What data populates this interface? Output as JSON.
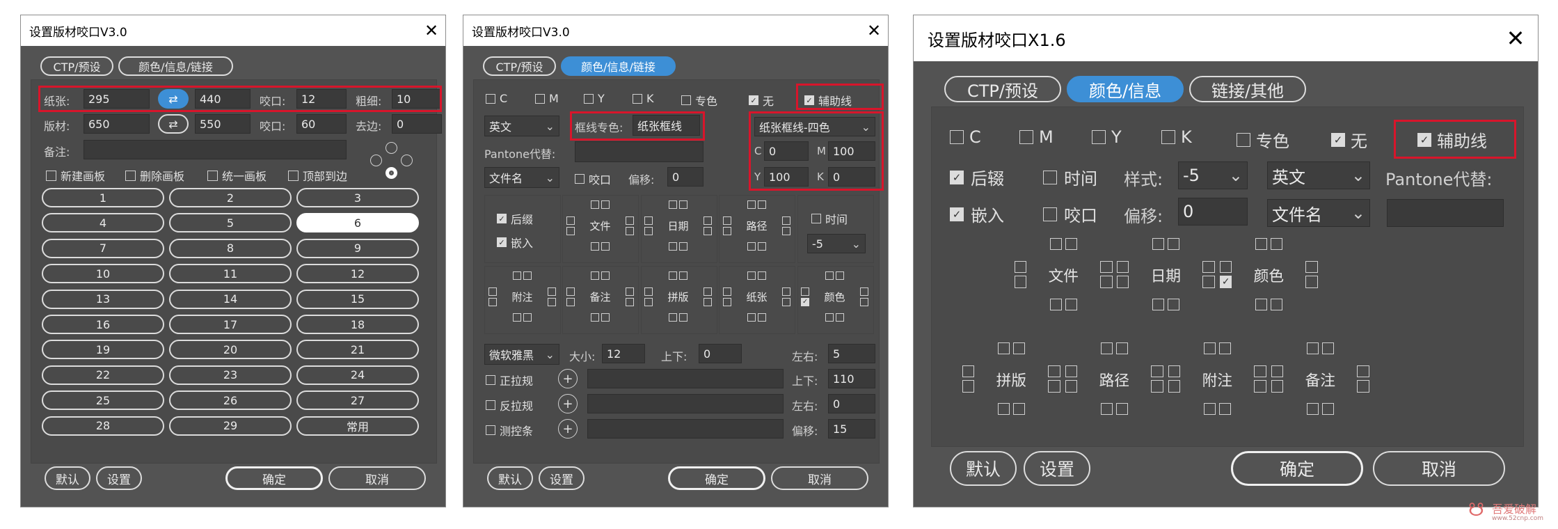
{
  "colors": {
    "window_bg": "#535353",
    "accent": "#3d8fd6",
    "highlight": "#d8152b"
  },
  "panel1": {
    "title": "设置版材咬口V3.0",
    "tabs": [
      "CTP/预设",
      "颜色/信息/链接"
    ],
    "paper_label": "纸张:",
    "paper_w": "295",
    "paper_h": "440",
    "bite_label": "咬口:",
    "paper_bite": "12",
    "thickness_label": "粗细:",
    "thickness": "10",
    "plate_label": "版材:",
    "plate_w": "650",
    "plate_h": "550",
    "plate_bite": "60",
    "margin_label": "去边:",
    "margin": "0",
    "note_label": "备注:",
    "options": [
      "新建画板",
      "删除画板",
      "统一画板",
      "顶部到边"
    ],
    "grid": [
      "1",
      "2",
      "3",
      "4",
      "5",
      "6",
      "7",
      "8",
      "9",
      "10",
      "11",
      "12",
      "13",
      "14",
      "15",
      "16",
      "17",
      "18",
      "19",
      "20",
      "21",
      "22",
      "23",
      "24",
      "25",
      "26",
      "27",
      "28",
      "29",
      "常用"
    ],
    "selected": "6",
    "btn_default": "默认",
    "btn_settings": "设置",
    "btn_ok": "确定",
    "btn_cancel": "取消"
  },
  "panel2": {
    "title": "设置版材咬口V3.0",
    "tabs": [
      "CTP/预设",
      "颜色/信息/链接"
    ],
    "checks": [
      {
        "label": "C",
        "checked": false
      },
      {
        "label": "M",
        "checked": false
      },
      {
        "label": "Y",
        "checked": false
      },
      {
        "label": "K",
        "checked": false
      },
      {
        "label": "专色",
        "checked": false
      },
      {
        "label": "无",
        "checked": true
      },
      {
        "label": "辅助线",
        "checked": true
      }
    ],
    "lang": "英文",
    "frame_spot_label": "框线专色:",
    "frame_spot_value": "纸张框线",
    "frame_type": "纸张框线-四色",
    "pantone_label": "Pantone代替:",
    "c_label": "C",
    "c": "0",
    "m_label": "M",
    "m": "100",
    "y_label": "Y",
    "y": "100",
    "k_label": "K",
    "k": "0",
    "filename": "文件名",
    "bite_check": "咬口",
    "offset_label": "偏移:",
    "offset": "0",
    "suffix": "后缀",
    "embed": "嵌入",
    "time": "时间",
    "time_style": "-5",
    "g_file": "文件",
    "g_date": "日期",
    "g_path": "路径",
    "g_note": "附注",
    "g_remark": "备注",
    "g_impose": "拼版",
    "g_paper": "纸张",
    "g_color": "颜色",
    "font": "微软雅黑",
    "size_label": "大小:",
    "size": "12",
    "ud_label": "上下:",
    "ud": "0",
    "lr_label": "左右:",
    "lr": "5",
    "pull1": "正拉规",
    "pull2": "反拉规",
    "ctrl": "测控条",
    "ud2": "110",
    "lr2": "0",
    "off_label2": "偏移:",
    "off2": "15",
    "btn_default": "默认",
    "btn_settings": "设置",
    "btn_ok": "确定",
    "btn_cancel": "取消"
  },
  "panel3": {
    "title": "设置版材咬口X1.6",
    "tabs": [
      "CTP/预设",
      "颜色/信息",
      "链接/其他"
    ],
    "checks": [
      {
        "label": "C",
        "checked": false
      },
      {
        "label": "M",
        "checked": false
      },
      {
        "label": "Y",
        "checked": false
      },
      {
        "label": "K",
        "checked": false
      },
      {
        "label": "专色",
        "checked": false
      },
      {
        "label": "无",
        "checked": true
      }
    ],
    "aux": "辅助线",
    "suffix": "后辍",
    "time": "时间",
    "style_label": "样式:",
    "style": "-5",
    "lang": "英文",
    "pantone_label": "Pantone代替:",
    "embed": "嵌入",
    "bite": "咬口",
    "offset_label": "偏移:",
    "offset": "0",
    "filename": "文件名",
    "g_file": "文件",
    "g_date": "日期",
    "g_color": "颜色",
    "g_impose": "拼版",
    "g_path": "路径",
    "g_note": "附注",
    "g_remark": "备注",
    "btn_default": "默认",
    "btn_settings": "设置",
    "btn_ok": "确定",
    "btn_cancel": "取消"
  },
  "watermark": {
    "cn": "吾爱破解",
    "url": "www.52cnp.com"
  }
}
